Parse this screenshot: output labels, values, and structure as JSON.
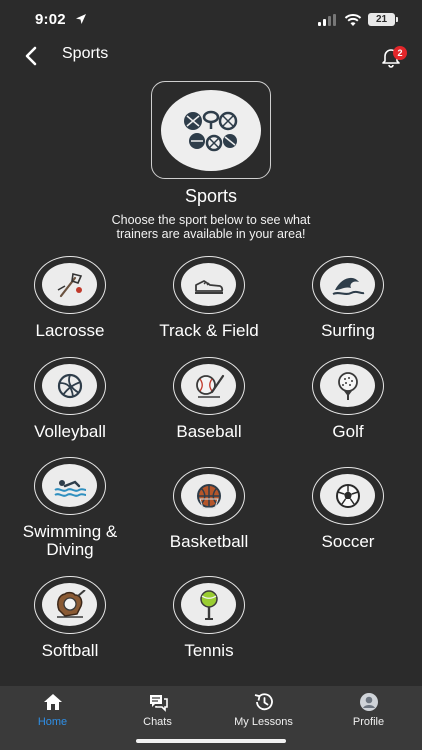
{
  "status_bar": {
    "time": "9:02",
    "battery": "21"
  },
  "header": {
    "title": "Sports",
    "notification_count": "2"
  },
  "hero": {
    "title": "Sports",
    "subtitle": "Choose the sport below to see what trainers are available in your area!"
  },
  "sports": [
    {
      "label": "Lacrosse",
      "icon": "lacrosse-icon"
    },
    {
      "label": "Track & Field",
      "icon": "sneaker-icon"
    },
    {
      "label": "Surfing",
      "icon": "wave-icon"
    },
    {
      "label": "Volleyball",
      "icon": "volleyball-icon"
    },
    {
      "label": "Baseball",
      "icon": "baseball-icon"
    },
    {
      "label": "Golf",
      "icon": "golf-ball-icon"
    },
    {
      "label": "Swimming & Diving",
      "icon": "swimmer-icon"
    },
    {
      "label": "Basketball",
      "icon": "basketball-icon"
    },
    {
      "label": "Soccer",
      "icon": "soccer-ball-icon"
    },
    {
      "label": "Softball",
      "icon": "softball-glove-icon"
    },
    {
      "label": "Tennis",
      "icon": "tennis-icon"
    }
  ],
  "tabbar": {
    "active": "Home",
    "tabs": [
      {
        "label": "Home",
        "icon": "home-icon"
      },
      {
        "label": "Chats",
        "icon": "chat-icon"
      },
      {
        "label": "My Lessons",
        "icon": "history-icon"
      },
      {
        "label": "Profile",
        "icon": "profile-icon"
      }
    ]
  },
  "colors": {
    "background": "#2b2b2b",
    "accent": "#2f8fe6",
    "badge": "#e3262a"
  }
}
